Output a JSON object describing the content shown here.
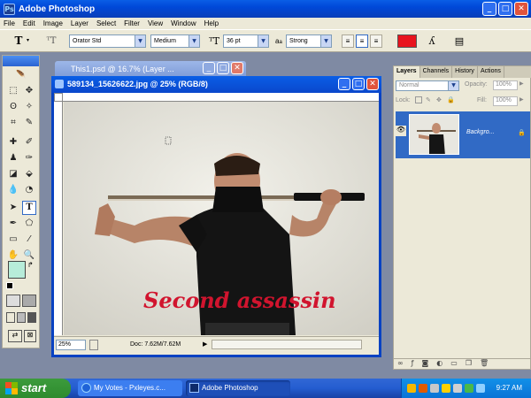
{
  "app": {
    "title": "Adobe Photoshop"
  },
  "menu": [
    "File",
    "Edit",
    "Image",
    "Layer",
    "Select",
    "Filter",
    "View",
    "Window",
    "Help"
  ],
  "options": {
    "tool_glyph": "T",
    "font_family": "Orator Std",
    "font_style": "Medium",
    "font_size": "36 pt",
    "aa_label": "a",
    "anti_alias": "Strong",
    "text_color": "#e8141e"
  },
  "docs": {
    "back_title": "This1.psd @ 16.7% (Layer ...",
    "front_title": "589134_15626622.jpg @ 25% (RGB/8)",
    "zoom": "25%",
    "doc_info": "Doc: 7.62M/7.62M",
    "canvas_text": "Second assassin",
    "canvas_text_color": "#d1142e"
  },
  "layers": {
    "tabs": [
      "Layers",
      "Channels",
      "History",
      "Actions"
    ],
    "blend_mode": "Normal",
    "opacity_label": "Opacity:",
    "opacity": "100%",
    "lock_label": "Lock:",
    "fill_label": "Fill:",
    "fill": "100%",
    "layer_name": "Backgro..."
  },
  "taskbar": {
    "start": "start",
    "tasks": [
      "My Votes - Pxleyes.c...",
      "Adobe Photoshop"
    ],
    "clock": "9:27 AM"
  },
  "colors": {
    "foreground": "#000000",
    "background_swatch": "#b7ecd9"
  }
}
